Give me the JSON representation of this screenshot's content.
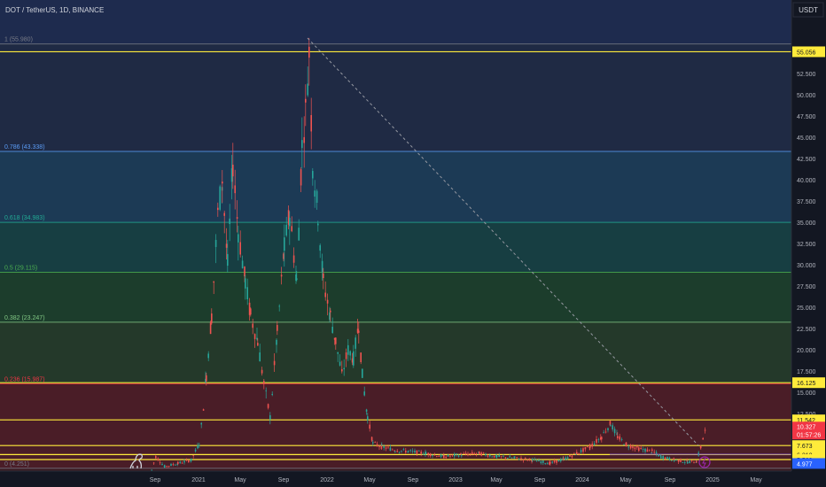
{
  "header": {
    "title": "DOT / TetherUS, 1D, BINANCE"
  },
  "price_axis": {
    "currency_label": "USDT",
    "ticks": [
      "52.500",
      "50.000",
      "47.500",
      "45.000",
      "42.500",
      "40.000",
      "37.500",
      "35.000",
      "32.500",
      "30.000",
      "27.500",
      "25.000",
      "22.500",
      "20.000",
      "17.500",
      "15.000",
      "12.500"
    ],
    "tick_values": [
      52.5,
      50,
      47.5,
      45,
      42.5,
      40,
      37.5,
      35,
      32.5,
      30,
      27.5,
      25,
      22.5,
      20,
      17.5,
      15,
      12.5
    ],
    "badges": [
      {
        "text": "55.056",
        "value": 55.056,
        "bg": "#ffeb3b",
        "fg": "#131722"
      },
      {
        "text": "16.125",
        "value": 16.125,
        "bg": "#ffeb3b",
        "fg": "#131722"
      },
      {
        "text": "11.542",
        "value": 11.542,
        "bg": "#ffeb3b",
        "fg": "#131722"
      },
      {
        "text": "7.673",
        "value": 7.673,
        "bg": "#ffeb3b",
        "fg": "#131722"
      },
      {
        "text": "6.312",
        "value": 6.312,
        "bg": "#ffeb3b",
        "fg": "#131722"
      },
      {
        "text": "5.568",
        "value": 5.568,
        "bg": "#ffeb3b",
        "fg": "#131722"
      },
      {
        "text": "4.977",
        "value": 4.977,
        "bg": "#2962ff",
        "fg": "#ffffff"
      }
    ],
    "current_price": {
      "price": "10.327",
      "countdown": "01:57:26",
      "value": 10.327,
      "bg": "#f23645"
    }
  },
  "time_axis": {
    "labels": [
      "Sep",
      "2021",
      "May",
      "Sep",
      "2022",
      "May",
      "Sep",
      "2023",
      "May",
      "Sep",
      "2024",
      "May",
      "Sep",
      "2025",
      "May"
    ]
  },
  "fib_levels": [
    {
      "label": "1 (55.980)",
      "value": 55.98,
      "color": "#787b86"
    },
    {
      "label": "0.786 (43.338)",
      "value": 43.338,
      "color": "#5b9cf6"
    },
    {
      "label": "0.618 (34.983)",
      "value": 34.983,
      "color": "#22ab94"
    },
    {
      "label": "0.5 (29.115)",
      "value": 29.115,
      "color": "#4caf50"
    },
    {
      "label": "0.382 (23.247)",
      "value": 23.247,
      "color": "#81c784"
    },
    {
      "label": "0.236 (15.987)",
      "value": 15.987,
      "color": "#f23645"
    },
    {
      "label": "0 (4.251)",
      "value": 4.251,
      "color": "#787b86"
    }
  ],
  "colors": {
    "up": "#26a69a",
    "down": "#ef5350",
    "horizontal_line": "#ffeb3b",
    "support_line": "#2962ff"
  },
  "icons": {
    "logo": "dinosaur-logo-icon",
    "alert": "lightning-alert-icon"
  }
}
